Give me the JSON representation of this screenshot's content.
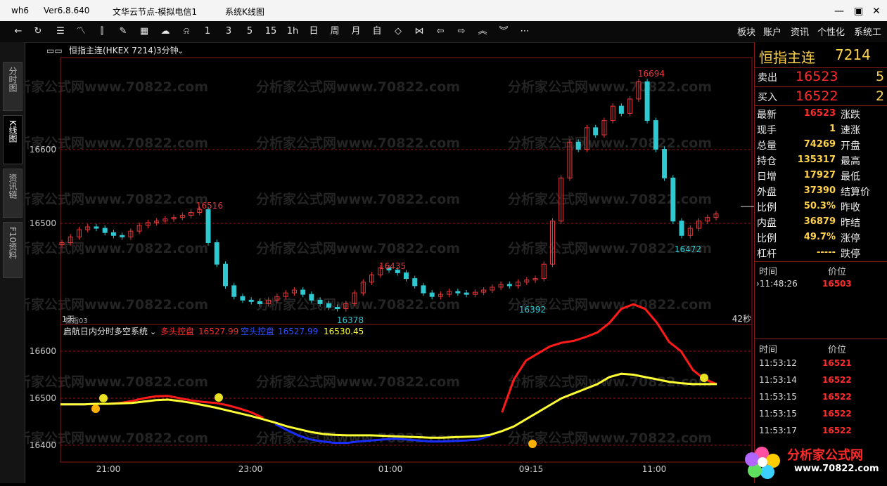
{
  "titlebar": {
    "app": "wh6",
    "version": "Ver6.8.640",
    "node": "文华云节点-模拟电信1",
    "window": "系统K线图"
  },
  "toolbar": {
    "periods": [
      "1",
      "3",
      "5",
      "15",
      "1h",
      "日",
      "周",
      "月",
      "自"
    ],
    "menus": [
      "板块",
      "账户",
      "资讯",
      "个性化",
      "系统工"
    ]
  },
  "left_tabs": [
    "分时图",
    "K线图",
    "资讯链",
    "F10资料"
  ],
  "chart_header": {
    "symbol": "恒指主连(HKEX 7214)",
    "period": "3分钟"
  },
  "watermark": "分析家公式网www.70822.com",
  "main_chart": {
    "y_labels": [
      "16600",
      "16500"
    ],
    "annotations": [
      "16694",
      "16516",
      "16435",
      "16472",
      "16392",
      "16378"
    ],
    "bottom_left": "1天",
    "bottom_left2": "恒指03",
    "countdown": "42秒"
  },
  "indicator": {
    "name": "启航日内分时多空系统",
    "long_label": "多头控盘",
    "long_value": "16527.99",
    "short_label": "空头控盘",
    "short_value": "16527.99",
    "yellow_value": "16530.45",
    "y_labels": [
      "16600",
      "16500",
      "16400"
    ]
  },
  "x_axis": [
    "21:00",
    "23:00",
    "01:00",
    "09:15",
    "11:00"
  ],
  "quote": {
    "name": "恒指主连",
    "code": "7214",
    "ask_label": "卖出",
    "ask_price": "16523",
    "ask_vol": "5",
    "bid_label": "买入",
    "bid_price": "16522",
    "bid_vol": "2",
    "stats": [
      {
        "label": "最新",
        "value": "16523",
        "right": "涨跌"
      },
      {
        "label": "现手",
        "value": "1",
        "right": "速涨"
      },
      {
        "label": "总量",
        "value": "74269",
        "right": "开盘"
      },
      {
        "label": "持仓",
        "value": "135317",
        "right": "最高"
      },
      {
        "label": "日增",
        "value": "17927",
        "right": "最低"
      },
      {
        "label": "外盘",
        "value": "37390",
        "right": "结算价"
      },
      {
        "label": "比例",
        "value": "50.3%",
        "right": "昨收"
      },
      {
        "label": "内盘",
        "value": "36879",
        "right": "昨结"
      },
      {
        "label": "比例",
        "value": "49.7%",
        "right": "涨停"
      },
      {
        "label": "杠杆",
        "value": "-----",
        "right": "跌停"
      }
    ],
    "ticks1_header": {
      "time": "时间",
      "price": "价位"
    },
    "ticks1": [
      {
        "time": "11:48:26",
        "price": "16503"
      }
    ],
    "ticks2_header": {
      "time": "时间",
      "price": "价位"
    },
    "ticks2": [
      {
        "time": "11:53:12",
        "price": "16521"
      },
      {
        "time": "11:53:14",
        "price": "16522"
      },
      {
        "time": "11:53:15",
        "price": "16522"
      },
      {
        "time": "11:53:15",
        "price": "16522"
      },
      {
        "time": "11:53:17",
        "price": "16522"
      }
    ]
  },
  "logo": {
    "text": "分析家公式网",
    "url": "www.70822.com"
  },
  "chart_data": {
    "type": "line",
    "candle_closes": [
      16470,
      16478,
      16488,
      16492,
      16490,
      16484,
      16480,
      16478,
      16486,
      16494,
      16498,
      16500,
      16503,
      16505,
      16508,
      16512,
      16516,
      16470,
      16440,
      16410,
      16395,
      16390,
      16388,
      16385,
      16390,
      16395,
      16400,
      16404,
      16398,
      16390,
      16385,
      16380,
      16378,
      16385,
      16400,
      16415,
      16425,
      16435,
      16432,
      16428,
      16420,
      16410,
      16400,
      16395,
      16398,
      16402,
      16400,
      16398,
      16401,
      16404,
      16408,
      16412,
      16410,
      16415,
      16418,
      16420,
      16440,
      16500,
      16560,
      16610,
      16600,
      16630,
      16620,
      16640,
      16660,
      16650,
      16670,
      16694,
      16640,
      16600,
      16560,
      16500,
      16480,
      16490,
      16500,
      16505,
      16510
    ],
    "long_line": [
      16487,
      16487,
      16487,
      16488,
      16488,
      16490,
      16494,
      16500,
      16504,
      16505,
      16500,
      16495,
      16492,
      16490,
      16485,
      16478,
      16470,
      16458,
      16445,
      16432,
      16420,
      16412,
      16408,
      16405,
      16405,
      16408,
      16410,
      16412,
      16414,
      16412,
      16410,
      16408,
      16408,
      16409,
      16410,
      16412,
      16420,
      16470,
      16540,
      16580,
      16595,
      16610,
      16618,
      16622,
      16630,
      16640,
      16660,
      16690,
      16700,
      16690,
      16660,
      16620,
      16600,
      16560,
      16540,
      16530
    ],
    "yellow_line": [
      16487,
      16487,
      16487,
      16488,
      16488,
      16489,
      16490,
      16493,
      16496,
      16497,
      16494,
      16490,
      16485,
      16480,
      16474,
      16468,
      16462,
      16455,
      16448,
      16440,
      16434,
      16428,
      16424,
      16422,
      16421,
      16421,
      16421,
      16420,
      16419,
      16418,
      16417,
      16416,
      16416,
      16417,
      16418,
      16419,
      16422,
      16430,
      16440,
      16455,
      16470,
      16485,
      16500,
      16510,
      16520,
      16530,
      16545,
      16552,
      16550,
      16545,
      16540,
      16535,
      16532,
      16530,
      16530,
      16530
    ],
    "ylim_main": [
      16360,
      16710
    ],
    "ylim_indicator": [
      16370,
      16630
    ]
  },
  "colors": {
    "up": "#e8383a",
    "down": "#2ec9d1",
    "long": "#ff1a1a",
    "short": "#1a2dff",
    "yellow": "#ffff33",
    "grid": "#7a1818"
  }
}
